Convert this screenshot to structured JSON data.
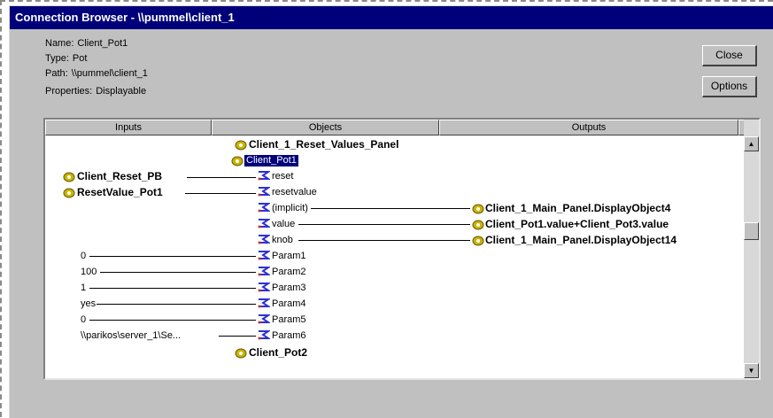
{
  "window": {
    "title": "Connection Browser - \\\\pummel\\client_1"
  },
  "info": {
    "name_label": "Name:",
    "name": "Client_Pot1",
    "type_label": "Type:",
    "type": "Pot",
    "path_label": "Path:",
    "path": "\\\\pummel\\client_1",
    "props_label": "Properties:",
    "props": "Displayable"
  },
  "buttons": {
    "close": "Close",
    "options": "Options"
  },
  "columns": {
    "inputs": "Inputs",
    "objects": "Objects",
    "outputs": "Outputs"
  },
  "objects": {
    "top": "Client_1_Reset_Values_Panel",
    "selected": "Client_Pot1",
    "bottom": "Client_Pot2"
  },
  "inputs": {
    "reset_pb": "Client_Reset_PB",
    "reset_value_pot": "ResetValue_Pot1",
    "p1": "0",
    "p2": "100",
    "p3": "1",
    "p4": "yes",
    "p5": "0",
    "p6": "\\\\parikos\\server_1\\Se..."
  },
  "props": {
    "reset": "reset",
    "resetvalue": "resetvalue",
    "implicit": "(implicit)",
    "value": "value",
    "knob": "knob",
    "param1": "Param1",
    "param2": "Param2",
    "param3": "Param3",
    "param4": "Param4",
    "param5": "Param5",
    "param6": "Param6"
  },
  "outputs": {
    "o1": "Client_1_Main_Panel.DisplayObject4",
    "o2": "Client_Pot1.value+Client_Pot3.value",
    "o3": "Client_1_Main_Panel.DisplayObject14"
  },
  "icons": {
    "object": "object-icon",
    "property": "property-pin-icon"
  }
}
